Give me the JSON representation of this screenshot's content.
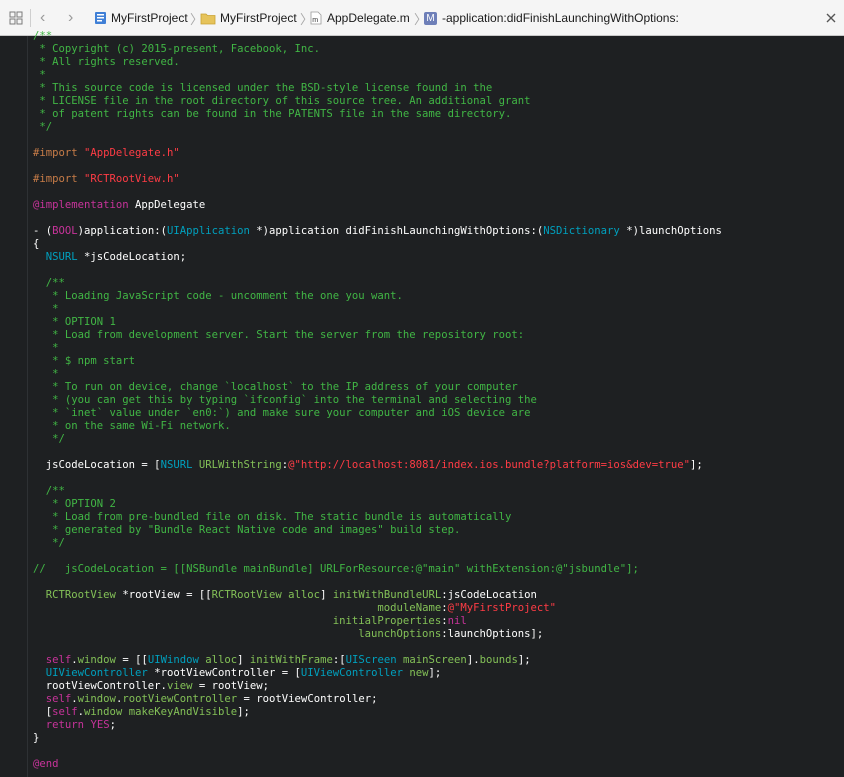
{
  "jumpbar": {
    "crumbs": [
      {
        "label": "MyFirstProject",
        "icon": "project-file-icon"
      },
      {
        "label": "MyFirstProject",
        "icon": "folder-icon"
      },
      {
        "label": "AppDelegate.m",
        "icon": "objc-m-file-icon"
      },
      {
        "label": "-application:didFinishLaunchingWithOptions:",
        "icon": "method-icon",
        "icon_letter": "M"
      }
    ],
    "icons": {
      "grid": "related-items-grid-icon",
      "back": "back-chevron-icon",
      "forward": "forward-chevron-icon",
      "close": "close-icon"
    }
  },
  "colors": {
    "background": "#1e2022",
    "comment": "#41b645",
    "preprocessor": "#c77c48",
    "string": "#ff3c45",
    "keyword": "#c7339a",
    "type": "#00a0be",
    "method": "#83c057",
    "plain": "#ffffff"
  },
  "code_lines": [
    [
      [
        "comment",
        "/**"
      ]
    ],
    [
      [
        "comment",
        " * Copyright (c) 2015-present, Facebook, Inc."
      ]
    ],
    [
      [
        "comment",
        " * All rights reserved."
      ]
    ],
    [
      [
        "comment",
        " *"
      ]
    ],
    [
      [
        "comment",
        " * This source code is licensed under the BSD-style license found in the"
      ]
    ],
    [
      [
        "comment",
        " * LICENSE file in the root directory of this source tree. An additional grant"
      ]
    ],
    [
      [
        "comment",
        " * of patent rights can be found in the PATENTS file in the same directory."
      ]
    ],
    [
      [
        "comment",
        " */"
      ]
    ],
    [],
    [
      [
        "pre",
        "#import "
      ],
      [
        "str",
        "\"AppDelegate.h\""
      ]
    ],
    [],
    [
      [
        "pre",
        "#import "
      ],
      [
        "str",
        "\"RCTRootView.h\""
      ]
    ],
    [],
    [
      [
        "kw",
        "@implementation"
      ],
      [
        "plain",
        " AppDelegate"
      ]
    ],
    [],
    [
      [
        "plain",
        "- ("
      ],
      [
        "kw",
        "BOOL"
      ],
      [
        "plain",
        ")application:("
      ],
      [
        "type",
        "UIApplication"
      ],
      [
        "plain",
        " *)application didFinishLaunchingWithOptions:("
      ],
      [
        "type",
        "NSDictionary"
      ],
      [
        "plain",
        " *)launchOptions"
      ]
    ],
    [
      [
        "plain",
        "{"
      ]
    ],
    [
      [
        "plain",
        "  "
      ],
      [
        "type",
        "NSURL"
      ],
      [
        "plain",
        " *jsCodeLocation;"
      ]
    ],
    [],
    [
      [
        "comment",
        "  /**"
      ]
    ],
    [
      [
        "comment",
        "   * Loading JavaScript code - uncomment the one you want."
      ]
    ],
    [
      [
        "comment",
        "   *"
      ]
    ],
    [
      [
        "comment",
        "   * OPTION 1"
      ]
    ],
    [
      [
        "comment",
        "   * Load from development server. Start the server from the repository root:"
      ]
    ],
    [
      [
        "comment",
        "   *"
      ]
    ],
    [
      [
        "comment",
        "   * $ npm start"
      ]
    ],
    [
      [
        "comment",
        "   *"
      ]
    ],
    [
      [
        "comment",
        "   * To run on device, change `localhost` to the IP address of your computer"
      ]
    ],
    [
      [
        "comment",
        "   * (you can get this by typing `ifconfig` into the terminal and selecting the"
      ]
    ],
    [
      [
        "comment",
        "   * `inet` value under `en0:`) and make sure your computer and iOS device are"
      ]
    ],
    [
      [
        "comment",
        "   * on the same Wi-Fi network."
      ]
    ],
    [
      [
        "comment",
        "   */"
      ]
    ],
    [],
    [
      [
        "plain",
        "  jsCodeLocation = ["
      ],
      [
        "type",
        "NSURL"
      ],
      [
        "plain",
        " "
      ],
      [
        "meth",
        "URLWithString"
      ],
      [
        "plain",
        ":"
      ],
      [
        "str",
        "@\"http://localhost:8081/index.ios.bundle?platform=ios&dev=true\""
      ],
      [
        "plain",
        "];"
      ]
    ],
    [],
    [
      [
        "comment",
        "  /**"
      ]
    ],
    [
      [
        "comment",
        "   * OPTION 2"
      ]
    ],
    [
      [
        "comment",
        "   * Load from pre-bundled file on disk. The static bundle is automatically"
      ]
    ],
    [
      [
        "comment",
        "   * generated by \"Bundle React Native code and images\" build step."
      ]
    ],
    [
      [
        "comment",
        "   */"
      ]
    ],
    [],
    [
      [
        "comment",
        "//   jsCodeLocation = [[NSBundle mainBundle] URLForResource:@\"main\" withExtension:@\"jsbundle\"];"
      ]
    ],
    [],
    [
      [
        "plain",
        "  "
      ],
      [
        "meth",
        "RCTRootView"
      ],
      [
        "plain",
        " *rootView = [["
      ],
      [
        "meth",
        "RCTRootView"
      ],
      [
        "plain",
        " "
      ],
      [
        "meth",
        "alloc"
      ],
      [
        "plain",
        "] "
      ],
      [
        "meth",
        "initWithBundleURL"
      ],
      [
        "plain",
        ":jsCodeLocation"
      ]
    ],
    [
      [
        "plain",
        "                                                      "
      ],
      [
        "meth",
        "moduleName"
      ],
      [
        "plain",
        ":"
      ],
      [
        "str",
        "@\"MyFirstProject\""
      ]
    ],
    [
      [
        "plain",
        "                                               "
      ],
      [
        "meth",
        "initialProperties"
      ],
      [
        "plain",
        ":"
      ],
      [
        "kw",
        "nil"
      ]
    ],
    [
      [
        "plain",
        "                                                   "
      ],
      [
        "meth",
        "launchOptions"
      ],
      [
        "plain",
        ":launchOptions];"
      ]
    ],
    [],
    [
      [
        "plain",
        "  "
      ],
      [
        "kw",
        "self"
      ],
      [
        "plain",
        "."
      ],
      [
        "meth",
        "window"
      ],
      [
        "plain",
        " = [["
      ],
      [
        "type",
        "UIWindow"
      ],
      [
        "plain",
        " "
      ],
      [
        "meth",
        "alloc"
      ],
      [
        "plain",
        "] "
      ],
      [
        "meth",
        "initWithFrame"
      ],
      [
        "plain",
        ":["
      ],
      [
        "type",
        "UIScreen"
      ],
      [
        "plain",
        " "
      ],
      [
        "meth",
        "mainScreen"
      ],
      [
        "plain",
        "]."
      ],
      [
        "meth",
        "bounds"
      ],
      [
        "plain",
        "];"
      ]
    ],
    [
      [
        "plain",
        "  "
      ],
      [
        "type",
        "UIViewController"
      ],
      [
        "plain",
        " *rootViewController = ["
      ],
      [
        "type",
        "UIViewController"
      ],
      [
        "plain",
        " "
      ],
      [
        "meth",
        "new"
      ],
      [
        "plain",
        "];"
      ]
    ],
    [
      [
        "plain",
        "  rootViewController."
      ],
      [
        "meth",
        "view"
      ],
      [
        "plain",
        " = rootView;"
      ]
    ],
    [
      [
        "plain",
        "  "
      ],
      [
        "kw",
        "self"
      ],
      [
        "plain",
        "."
      ],
      [
        "meth",
        "window"
      ],
      [
        "plain",
        "."
      ],
      [
        "meth",
        "rootViewController"
      ],
      [
        "plain",
        " = rootViewController;"
      ]
    ],
    [
      [
        "plain",
        "  ["
      ],
      [
        "kw",
        "self"
      ],
      [
        "plain",
        "."
      ],
      [
        "meth",
        "window"
      ],
      [
        "plain",
        " "
      ],
      [
        "meth",
        "makeKeyAndVisible"
      ],
      [
        "plain",
        "];"
      ]
    ],
    [
      [
        "plain",
        "  "
      ],
      [
        "kw",
        "return"
      ],
      [
        "plain",
        " "
      ],
      [
        "kw",
        "YES"
      ],
      [
        "plain",
        ";"
      ]
    ],
    [
      [
        "plain",
        "}"
      ]
    ],
    [],
    [
      [
        "kw",
        "@end"
      ]
    ]
  ]
}
